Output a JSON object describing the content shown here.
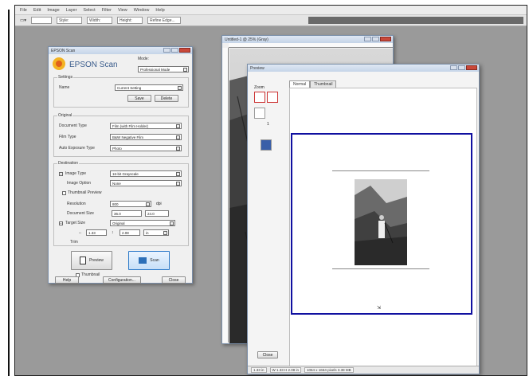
{
  "app": {
    "menu": [
      "File",
      "Edit",
      "Image",
      "Layer",
      "Select",
      "Filter",
      "View",
      "Window",
      "Help"
    ],
    "toolbar": {
      "field1": "Style:",
      "field2": "Width:",
      "field3": "Height:",
      "field4": "Refine Edge..."
    }
  },
  "epson": {
    "title": "EPSON Scan",
    "brand": "EPSON Scan",
    "mode_label": "Mode:",
    "mode_value": "Professional Mode",
    "settings_legend": "Settings",
    "name_label": "Name",
    "name_value": "Current Setting",
    "save_btn": "Save",
    "delete_btn": "Delete",
    "original_legend": "Original",
    "doc_type_label": "Document Type",
    "doc_type_value": "Film (with Film Holder)",
    "film_type_label": "Film Type",
    "film_type_value": "B&W Negative Film",
    "auto_exposure_label": "Auto Exposure Type",
    "auto_exposure_value": "Photo",
    "destination_legend": "Destination",
    "image_type_label": "Image Type",
    "image_type_value": "16-bit Grayscale",
    "image_option_label": "Image Option",
    "image_option_value": "None",
    "scan_multi_label": "Thumbnail Preview",
    "resolution_label": "Resolution",
    "resolution_value": "800",
    "unit_label": "dpi",
    "doc_size_label": "Document Size",
    "doc_size_w": "36.0",
    "doc_size_h": "24.0",
    "target_size_label": "Target Size",
    "target_size_value": "Original",
    "trim_label": "Trim",
    "dim_w": "1.33",
    "dim_h": "2.08",
    "unit2": "in",
    "preview_btn": "Preview",
    "scan_btn": "Scan",
    "thumbnail_label": "Thumbnail",
    "help_btn": "Help",
    "config_btn": "Configuration...",
    "close_btn": "Close"
  },
  "image_window": {
    "title": "Untitled-1 @ 25% (Gray)"
  },
  "preview": {
    "title": "Preview",
    "tab_normal": "Normal",
    "tab_thumbnail": "Thumbnail",
    "sidebar_label": "Zoom",
    "page_marker": "1",
    "bottom_btn": "Close",
    "status_1": "1.33 in",
    "status_2": "W 1.33  H 2.08 in",
    "status_3": "1064 x 1664 pixels 3.38 MB"
  }
}
